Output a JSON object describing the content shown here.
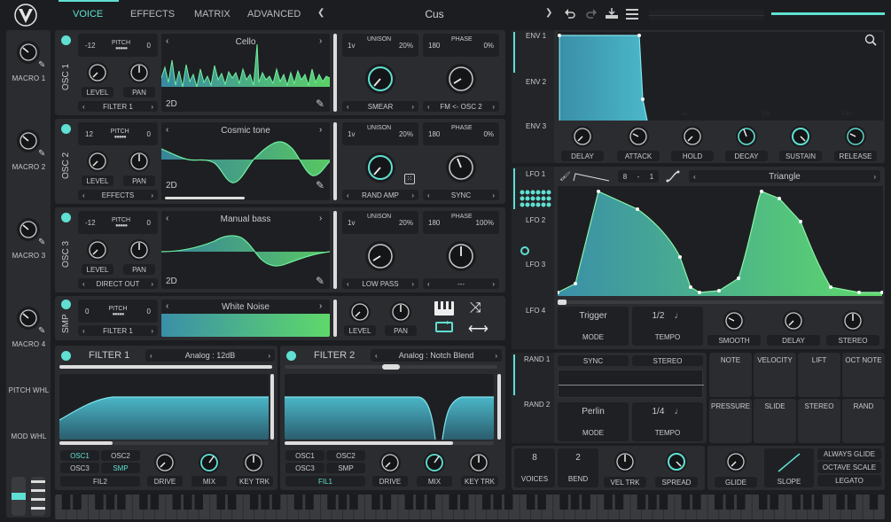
{
  "tabs": [
    "VOICE",
    "EFFECTS",
    "MATRIX",
    "ADVANCED"
  ],
  "preset": {
    "name": "Cus"
  },
  "macros": [
    {
      "label": "MACRO 1"
    },
    {
      "label": "MACRO 2"
    },
    {
      "label": "MACRO 3"
    },
    {
      "label": "MACRO 4"
    }
  ],
  "wheels": {
    "pitch": "PITCH WHL",
    "mod": "MOD WHL"
  },
  "osc": [
    {
      "label": "OSC 1",
      "pitch_l": "-12",
      "pitch_r": "0",
      "wave": "Cello",
      "dest": "FILTER 1",
      "unison_v": "1v",
      "unison_p": "20%",
      "phase_v": "180",
      "phase_p": "0%",
      "mode1": "SMEAR",
      "mode2": "FM <- OSC 2"
    },
    {
      "label": "OSC 2",
      "pitch_l": "12",
      "pitch_r": "0",
      "wave": "Cosmic tone",
      "dest": "EFFECTS",
      "unison_v": "1v",
      "unison_p": "20%",
      "phase_v": "180",
      "phase_p": "0%",
      "mode1": "RAND AMP",
      "mode2": "SYNC"
    },
    {
      "label": "OSC 3",
      "pitch_l": "-12",
      "pitch_r": "0",
      "wave": "Manual bass",
      "dest": "DIRECT OUT",
      "unison_v": "1v",
      "unison_p": "20%",
      "phase_v": "180",
      "phase_p": "100%",
      "mode1": "LOW PASS",
      "mode2": "---"
    }
  ],
  "common": {
    "pitch": "PITCH",
    "level": "LEVEL",
    "pan": "PAN",
    "unison": "UNISON",
    "phase": "PHASE",
    "twod": "2D"
  },
  "smp": {
    "label": "SMP",
    "pitch_l": "0",
    "pitch_r": "0",
    "wave": "White Noise",
    "dest": "FILTER 1"
  },
  "filters": [
    {
      "title": "FILTER 1",
      "model": "Analog : 12dB",
      "sel": "FIL2",
      "src": [
        "OSC1",
        "OSC2",
        "OSC3",
        "SMP"
      ],
      "active": [
        "OSC1",
        "SMP"
      ]
    },
    {
      "title": "FILTER 2",
      "model": "Analog : Notch Blend",
      "sel": "FIL1",
      "src": [
        "OSC1",
        "OSC2",
        "OSC3",
        "SMP"
      ],
      "active": []
    }
  ],
  "filter_knobs": [
    "DRIVE",
    "MIX",
    "KEY TRK"
  ],
  "env": {
    "tabs": [
      "ENV 1",
      "ENV 2",
      "ENV 3"
    ],
    "knobs": [
      "DELAY",
      "ATTACK",
      "HOLD",
      "DECAY",
      "SUSTAIN",
      "RELEASE"
    ],
    "ticks": [
      "1s",
      "10s",
      "100s"
    ]
  },
  "lfo": {
    "tabs": [
      "LFO 1",
      "LFO 2",
      "LFO 3",
      "LFO 4"
    ],
    "grid_n": "8",
    "grid_d": "1",
    "shape": "Triangle",
    "mode_val": "Trigger",
    "mode": "MODE",
    "tempo_val": "1/2",
    "tempo": "TEMPO",
    "knobs": [
      "SMOOTH",
      "DELAY",
      "STEREO"
    ]
  },
  "rand": {
    "tabs": [
      "RAND 1",
      "RAND 2"
    ],
    "sync": "SYNC",
    "stereo": "STEREO",
    "mode_val": "Perlin",
    "mode": "MODE",
    "tempo_val": "1/4",
    "tempo": "TEMPO"
  },
  "mods": [
    [
      "NOTE",
      "VELOCITY",
      "LIFT",
      "OCT NOTE"
    ],
    [
      "PRESSURE",
      "SLIDE",
      "STEREO",
      "RAND"
    ]
  ],
  "voice": {
    "voices_val": "8",
    "voices": "VOICES",
    "bend_val": "2",
    "bend": "BEND",
    "veltrk": "VEL TRK",
    "spread": "SPREAD",
    "glide": "GLIDE",
    "slope": "SLOPE",
    "always_glide": "ALWAYS GLIDE",
    "octave_scale": "OCTAVE SCALE",
    "legato": "LEGATO"
  }
}
